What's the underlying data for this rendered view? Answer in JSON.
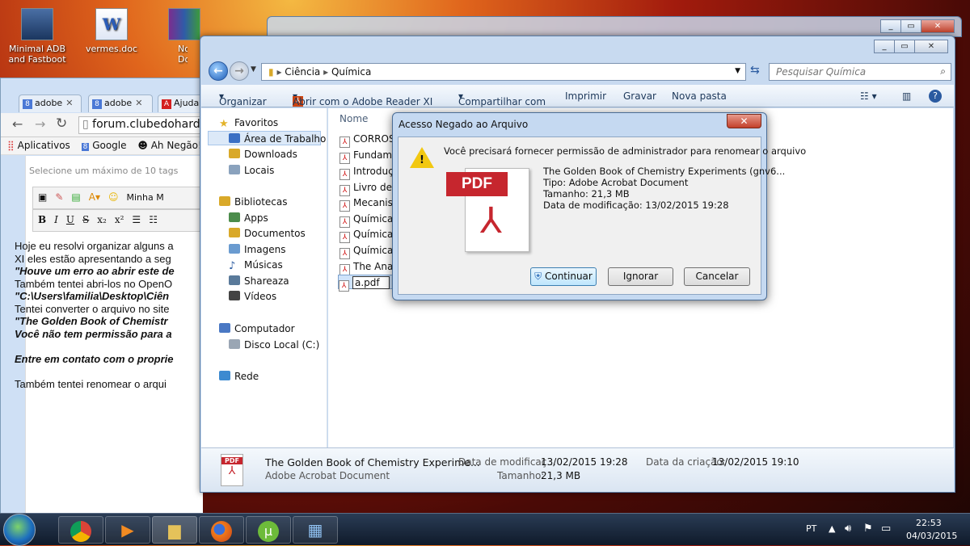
{
  "desktop": {
    "icons": [
      {
        "label": "Minimal ADB and Fastboot"
      },
      {
        "label": "vermes.doc"
      },
      {
        "label": "Nov Docume"
      }
    ]
  },
  "chrome": {
    "tabs": [
      {
        "label": "adobe"
      },
      {
        "label": "adobe"
      },
      {
        "label": "Ajuda"
      }
    ],
    "url": "forum.clubedohardw",
    "bookmarks": {
      "apps": "Aplicativos",
      "google": "Google",
      "ahnegao": "Ah Negão!"
    },
    "tags_hint": "Selecione um máximo de 10 tags",
    "editor_toolbar_text": "Minha M",
    "post_lines": [
      "Hoje eu resolvi organizar alguns a",
      "XI eles estão apresentando a seg",
      "\"Houve um erro ao abrir este de",
      "Também tentei abri-los no OpenO",
      "\"C:\\Users\\familia\\Desktop\\Ciên",
      "Tentei converter o arquivo no site",
      "\"The Golden Book of Chemistr",
      "Você não tem permissão para a",
      "",
      "Entre em contato com o proprie",
      "",
      "Também tentei renomear o arqui"
    ]
  },
  "explorer": {
    "breadcrumb": [
      "Ciência",
      "Química"
    ],
    "search_placeholder": "Pesquisar Química",
    "commands": {
      "organize": "Organizar",
      "open_with": "Abrir com o Adobe Reader XI",
      "share": "Compartilhar com",
      "print": "Imprimir",
      "burn": "Gravar",
      "new_folder": "Nova pasta"
    },
    "nav": {
      "favorites": "Favoritos",
      "desktop": "Área de Trabalho",
      "downloads": "Downloads",
      "places": "Locais",
      "libraries": "Bibliotecas",
      "apps": "Apps",
      "documents": "Documentos",
      "images": "Imagens",
      "music": "Músicas",
      "shareaza": "Shareaza",
      "videos": "Vídeos",
      "computer": "Computador",
      "local_disk": "Disco Local (C:)",
      "network": "Rede"
    },
    "column_name": "Nome",
    "files": [
      {
        "name": "CORROS"
      },
      {
        "name": "Fundame"
      },
      {
        "name": "Introduç"
      },
      {
        "name": "Livro de"
      },
      {
        "name": "Mecanism"
      },
      {
        "name": "Química"
      },
      {
        "name": "Química"
      },
      {
        "name": "Química"
      },
      {
        "name": "The Anar"
      }
    ],
    "renaming_value": "a.pdf",
    "details": {
      "filename": "The Golden Book of Chemistry Experime...",
      "type": "Adobe Acrobat Document",
      "modified_label": "Data de modificaç...",
      "modified_value": "13/02/2015 19:28",
      "size_label": "Tamanho:",
      "size_value": "21,3 MB",
      "created_label": "Data da criação:",
      "created_value": "13/02/2015 19:10"
    }
  },
  "dialog": {
    "title": "Acesso Negado ao Arquivo",
    "message": "Você precisará fornecer permissão de administrador para renomear o arquivo",
    "pdf_label": "PDF",
    "file_name": "The Golden Book of Chemistry Experiments (gnv6...",
    "file_type": "Tipo: Adobe Acrobat Document",
    "file_size": "Tamanho: 21,3 MB",
    "file_modified": "Data de modificação: 13/02/2015 19:28",
    "buttons": {
      "continue": "Continuar",
      "ignore": "Ignorar",
      "cancel": "Cancelar"
    }
  },
  "taskbar": {
    "lang": "PT",
    "time": "22:53",
    "date": "04/03/2015"
  }
}
